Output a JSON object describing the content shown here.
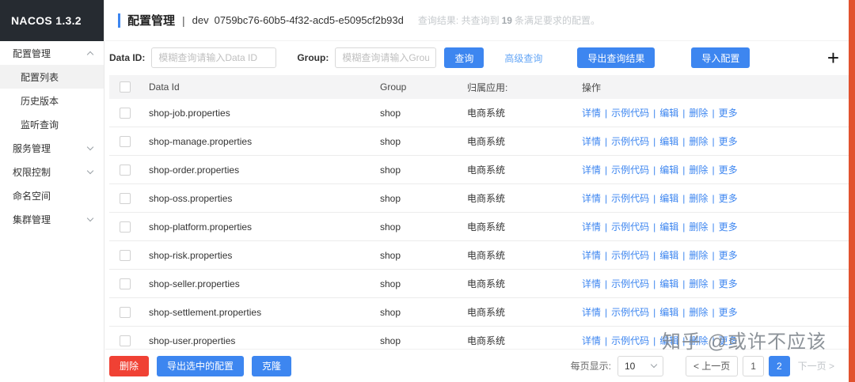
{
  "app": {
    "brand": "NACOS 1.3.2"
  },
  "colors": {
    "accent_blue": "#3d86f0",
    "danger_red": "#f04134",
    "brand_dark": "#262b31",
    "right_strip": "#e2522e"
  },
  "sidebar": {
    "items": [
      {
        "label": "配置管理",
        "expanded": true
      },
      {
        "label": "配置列表",
        "active": true
      },
      {
        "label": "历史版本"
      },
      {
        "label": "监听查询"
      },
      {
        "label": "服务管理"
      },
      {
        "label": "权限控制"
      },
      {
        "label": "命名空间"
      },
      {
        "label": "集群管理"
      }
    ]
  },
  "header": {
    "title": "配置管理",
    "separator": "|",
    "env": "dev",
    "namespace_id": "0759bc76-60b5-4f32-acd5-e5095cf2b93d",
    "result_label": "查询结果:",
    "result_prefix": "共查询到",
    "result_count": "19",
    "result_suffix": "条满足要求的配置。"
  },
  "search": {
    "data_id_label": "Data ID:",
    "data_id_placeholder": "模糊查询请输入Data ID",
    "group_label": "Group:",
    "group_placeholder": "模糊查询请输入Group",
    "query_button": "查询",
    "advanced_query_link": "高级查询",
    "export_button": "导出查询结果",
    "import_button": "导入配置",
    "plus_icon": "+"
  },
  "table": {
    "headers": [
      "Data Id",
      "Group",
      "归属应用:",
      "操作"
    ],
    "actions": [
      "详情",
      "示例代码",
      "编辑",
      "删除",
      "更多"
    ],
    "rows": [
      {
        "data_id": "shop-job.properties",
        "group": "shop",
        "app": "电商系统"
      },
      {
        "data_id": "shop-manage.properties",
        "group": "shop",
        "app": "电商系统"
      },
      {
        "data_id": "shop-order.properties",
        "group": "shop",
        "app": "电商系统"
      },
      {
        "data_id": "shop-oss.properties",
        "group": "shop",
        "app": "电商系统"
      },
      {
        "data_id": "shop-platform.properties",
        "group": "shop",
        "app": "电商系统"
      },
      {
        "data_id": "shop-risk.properties",
        "group": "shop",
        "app": "电商系统"
      },
      {
        "data_id": "shop-seller.properties",
        "group": "shop",
        "app": "电商系统"
      },
      {
        "data_id": "shop-settlement.properties",
        "group": "shop",
        "app": "电商系统"
      },
      {
        "data_id": "shop-user.properties",
        "group": "shop",
        "app": "电商系统"
      }
    ]
  },
  "footer": {
    "delete_button": "删除",
    "export_selected_button": "导出选中的配置",
    "clone_button": "克隆",
    "page_size_label": "每页显示:",
    "page_size_value": "10",
    "prev_button": "< 上一页",
    "page_1": "1",
    "page_2": "2",
    "next_button": "下一页 >"
  },
  "watermark": "知乎 @或许不应该"
}
